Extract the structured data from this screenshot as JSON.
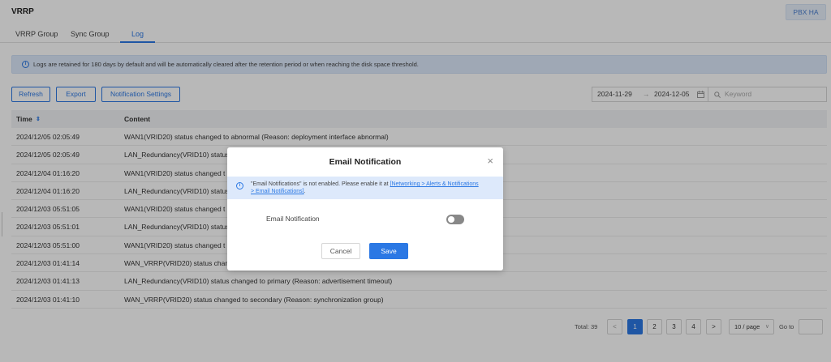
{
  "header": {
    "title": "VRRP",
    "pbx_button": "PBX HA"
  },
  "tabs": [
    {
      "label": "VRRP Group"
    },
    {
      "label": "Sync Group"
    },
    {
      "label": "Log",
      "active": true
    }
  ],
  "info_bar": {
    "text": "Logs are retained for 180 days by default and will be automatically cleared after the retention period or when reaching the disk space threshold."
  },
  "toolbar": {
    "refresh": "Refresh",
    "export": "Export",
    "notification_settings": "Notification Settings",
    "date_from": "2024-11-29",
    "date_to": "2024-12-05",
    "date_separator": "→",
    "keyword_placeholder": "Keyword"
  },
  "table": {
    "columns": {
      "time": "Time",
      "content": "Content",
      "sort_glyph": "⇕"
    },
    "rows": [
      {
        "time": "2024/12/05 02:05:49",
        "content": "WAN1(VRID20) status changed to abnormal (Reason: deployment interface abnormal)"
      },
      {
        "time": "2024/12/05 02:05:49",
        "content": "LAN_Redundancy(VRID10) status"
      },
      {
        "time": "2024/12/04 01:16:20",
        "content": "WAN1(VRID20) status changed t"
      },
      {
        "time": "2024/12/04 01:16:20",
        "content": "LAN_Redundancy(VRID10) status"
      },
      {
        "time": "2024/12/03 05:51:05",
        "content": "WAN1(VRID20) status changed t"
      },
      {
        "time": "2024/12/03 05:51:01",
        "content": "LAN_Redundancy(VRID10) status"
      },
      {
        "time": "2024/12/03 05:51:00",
        "content": "WAN1(VRID20) status changed t"
      },
      {
        "time": "2024/12/03 01:41:14",
        "content": "WAN_VRRP(VRID20) status chan"
      },
      {
        "time": "2024/12/03 01:41:13",
        "content": "LAN_Redundancy(VRID10) status changed to primary (Reason: advertisement timeout)"
      },
      {
        "time": "2024/12/03 01:41:10",
        "content": "WAN_VRRP(VRID20) status changed to secondary (Reason: synchronization group)"
      }
    ]
  },
  "pagination": {
    "total": "Total: 39",
    "prev": "<",
    "next": ">",
    "pages": [
      "1",
      "2",
      "3",
      "4"
    ],
    "current": "1",
    "page_size": "10 / page",
    "goto_label": "Go to"
  },
  "modal": {
    "title": "Email Notification",
    "close": "×",
    "alert_prefix": "\"Email Notifications\" is not enabled. Please enable it at ",
    "alert_link": "[Networking > Alerts & Notifications > Email Notifications]",
    "alert_suffix": ".",
    "toggle_label": "Email Notification",
    "toggle_on": false,
    "cancel": "Cancel",
    "save": "Save"
  },
  "colors": {
    "accent": "#2b78e4",
    "info_bg": "#dde9fb"
  }
}
